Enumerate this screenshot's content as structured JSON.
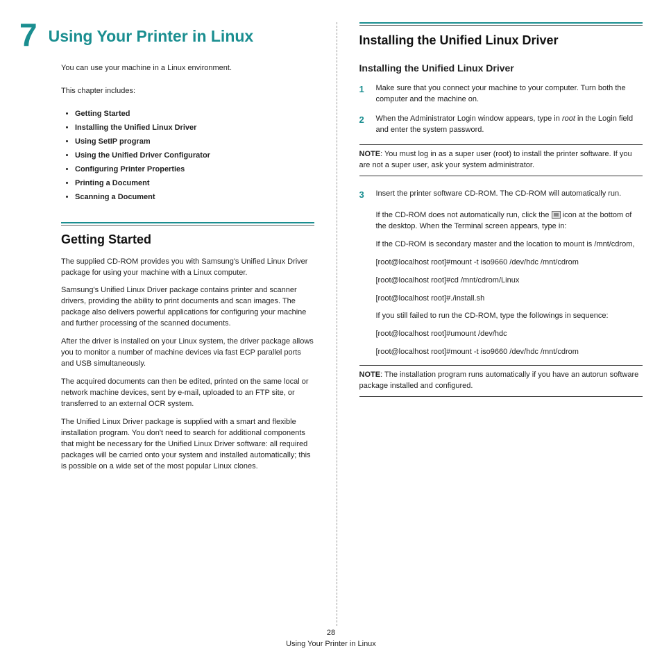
{
  "chapter": {
    "number": "7",
    "title": "Using Your Printer in Linux"
  },
  "intro": {
    "line1": "You can use your machine in a Linux environment.",
    "line2": "This chapter includes:"
  },
  "toc": [
    "Getting Started",
    "Installing the Unified Linux Driver",
    "Using SetIP program",
    "Using the Unified Driver Configurator",
    "Configuring Printer Properties",
    "Printing a Document",
    "Scanning a Document"
  ],
  "getting_started": {
    "title": "Getting Started",
    "p1": "The supplied CD-ROM provides you with Samsung's Unified Linux Driver package for using your machine with a Linux computer.",
    "p2": "Samsung's Unified Linux Driver package contains printer and scanner drivers, providing the ability to print documents and scan images. The package also delivers powerful applications for configuring your machine and further processing of the scanned documents.",
    "p3": "After the driver is installed on your Linux system, the driver package allows you to monitor a number of machine devices via fast ECP parallel ports and USB simultaneously.",
    "p4": "The acquired documents can then be edited, printed on the same local or network machine devices, sent by e-mail, uploaded to an FTP site, or transferred to an external OCR system.",
    "p5": "The Unified Linux Driver package is supplied with a smart and flexible installation program. You don't need to search for additional components that might be necessary for the Unified Linux Driver software: all required packages will be carried onto your system and installed automatically; this is possible on a wide set of the most popular Linux clones."
  },
  "install": {
    "title": "Installing the Unified Linux Driver",
    "subtitle": "Installing the Unified Linux Driver",
    "step1": "Make sure that you connect your machine to your computer. Turn both the computer and the machine on.",
    "step2_a": "When the Administrator Login window appears, type in ",
    "step2_root": "root",
    "step2_b": " in the Login field and enter the system password.",
    "note1_label": "NOTE",
    "note1": ": You must log in as a super user (root) to install the printer software. If you are not a super user, ask your system administrator.",
    "step3": "Insert the printer software CD-ROM. The CD-ROM will automatically run.",
    "block": {
      "p1a": "If the CD-ROM does not automatically run, click the ",
      "p1b": " icon at the bottom of the desktop. When the Terminal screen appears, type in:",
      "p2": "If the CD-ROM is secondary master and the location to mount is /mnt/cdrom,",
      "p3": "[root@localhost root]#mount -t iso9660 /dev/hdc /mnt/cdrom",
      "p4": "[root@localhost root]#cd /mnt/cdrom/Linux",
      "p5": "[root@localhost root]#./install.sh",
      "p6": "If you still failed to run the CD-ROM, type the followings in sequence:",
      "p7": "[root@localhost root]#umount /dev/hdc",
      "p8": "[root@localhost root]#mount -t iso9660 /dev/hdc /mnt/cdrom"
    },
    "note2_label": "NOTE",
    "note2": ": The installation program runs automatically if you have an autorun software package installed and configured."
  },
  "footer": {
    "page": "28",
    "caption": "Using Your Printer in Linux"
  }
}
